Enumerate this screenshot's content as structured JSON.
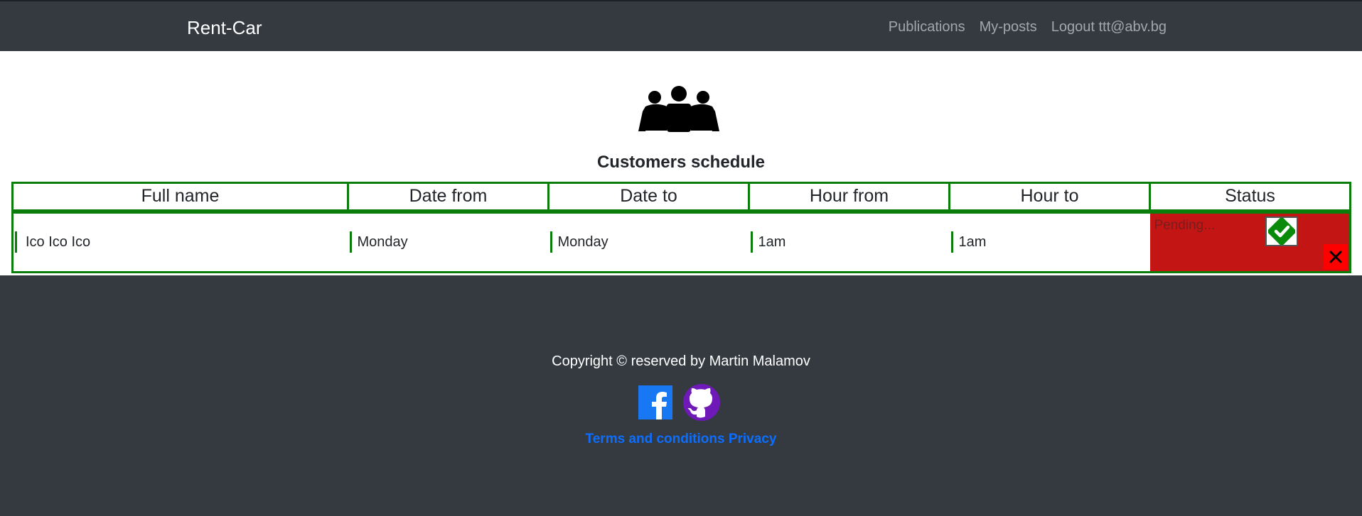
{
  "navbar": {
    "brand": "Rent-Car",
    "links": [
      "Publications",
      "My-posts",
      "Logout ttt@abv.bg"
    ]
  },
  "page": {
    "title": "Customers schedule",
    "icon": "users-group-icon"
  },
  "table": {
    "headers": [
      "Full name",
      "Date from",
      "Date to",
      "Hour from",
      "Hour to",
      "Status"
    ],
    "rows": [
      {
        "full_name": "Ico Ico Ico",
        "date_from": "Monday",
        "date_to": "Monday",
        "hour_from": "1am",
        "hour_to": "1am",
        "status": "Pending..."
      }
    ],
    "accept_icon": "check-icon",
    "reject_icon": "close-icon"
  },
  "footer": {
    "copyright": "Copyright © reserved by Martin Malamov",
    "social": [
      "facebook-icon",
      "github-icon"
    ],
    "terms": "Terms and conditions",
    "privacy": "Privacy"
  },
  "colors": {
    "navbar": "#343a40",
    "table_border": "#0a7d0a",
    "status_bg": "#c41515",
    "reject_bg": "#ff0000",
    "link": "#0d6efd",
    "github": "#6f1ab8",
    "facebook": "#1877f2"
  }
}
